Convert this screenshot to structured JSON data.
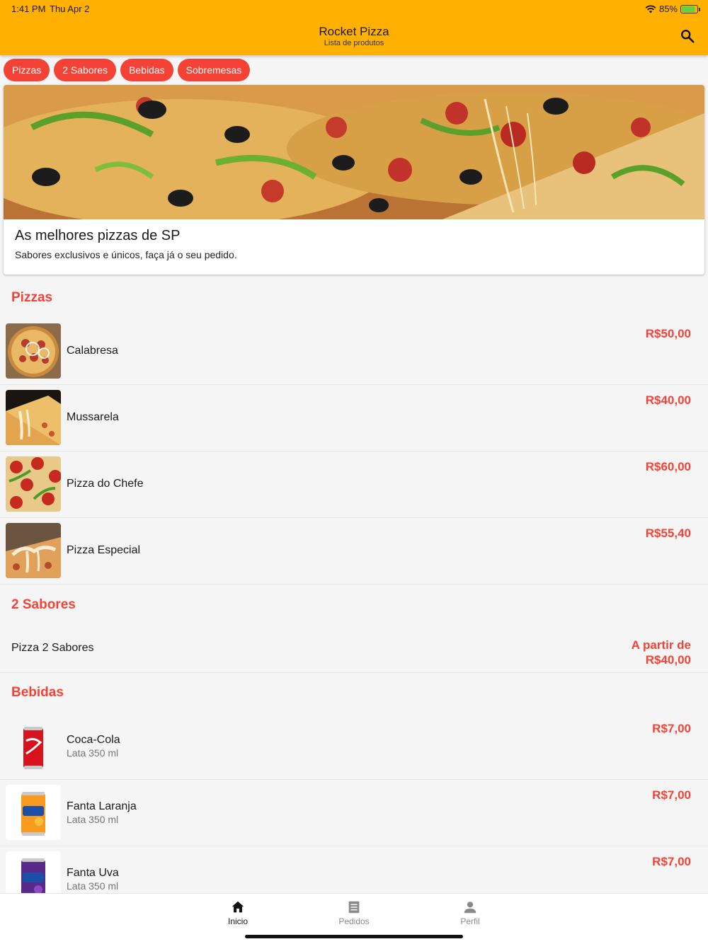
{
  "status_bar": {
    "time": "1:41 PM",
    "date": "Thu Apr 2",
    "battery": "85%",
    "battery_level": 0.85
  },
  "header": {
    "title": "Rocket Pizza",
    "subtitle": "Lista de produtos",
    "search_icon": "search-icon"
  },
  "chips": [
    "Pizzas",
    "2 Sabores",
    "Bebidas",
    "Sobremesas"
  ],
  "banner": {
    "title": "As melhores pizzas de SP",
    "subtitle": "Sabores exclusivos e únicos, faça já o seu pedido."
  },
  "sections": {
    "pizzas": {
      "title": "Pizzas",
      "items": [
        {
          "name": "Calabresa",
          "price": "R$50,00"
        },
        {
          "name": "Mussarela",
          "price": "R$40,00"
        },
        {
          "name": "Pizza do Chefe",
          "price": "R$60,00"
        },
        {
          "name": "Pizza Especial",
          "price": "R$55,40"
        }
      ]
    },
    "dois_sabores": {
      "title": "2 Sabores",
      "items": [
        {
          "name": "Pizza 2 Sabores",
          "price_line1": "A partir de",
          "price_line2": "R$40,00"
        }
      ]
    },
    "bebidas": {
      "title": "Bebidas",
      "items": [
        {
          "name": "Coca-Cola",
          "detail": "Lata 350 ml",
          "price": "R$7,00"
        },
        {
          "name": "Fanta Laranja",
          "detail": "Lata 350 ml",
          "price": "R$7,00"
        },
        {
          "name": "Fanta Uva",
          "detail": "Lata 350 ml",
          "price": "R$7,00"
        }
      ]
    }
  },
  "bottom_nav": [
    {
      "label": "Inicio",
      "icon": "home-icon",
      "active": true
    },
    {
      "label": "Pedidos",
      "icon": "list-icon",
      "active": false
    },
    {
      "label": "Perfil",
      "icon": "person-icon",
      "active": false
    }
  ],
  "colors": {
    "header": "#ffb000",
    "accent": "#f44336",
    "background": "#f5f5f5"
  }
}
